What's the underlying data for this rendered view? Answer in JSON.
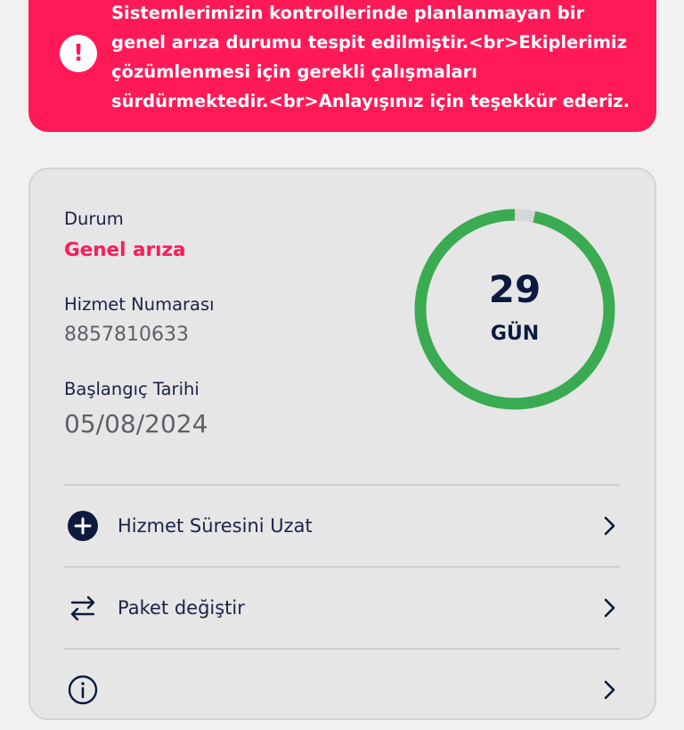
{
  "alert": {
    "icon": "exclamation-icon",
    "message": "Sistemlerimizin kontrollerinde planlanmayan bir\ngenel arıza durumu tespit edilmiştir.<br>Ekiplerimiz\nçözümlenmesi için gerekli çalışmaları\nsürdürmektedir.<br>Anlayışınız için teşekkür ederiz.",
    "color": "#ff1a57"
  },
  "service": {
    "status_label": "Durum",
    "status_value": "Genel arıza",
    "number_label": "Hizmet Numarası",
    "number_value": "8857810633",
    "start_label": "Başlangıç Tarihi",
    "start_value": "05/08/2024"
  },
  "countdown": {
    "days": "29",
    "unit": "GÜN",
    "progress_fraction": 0.967,
    "ring_color": "#3bab52",
    "track_color": "#d6d6d6"
  },
  "actions": [
    {
      "label": "Hizmet Süresini Uzat",
      "icon": "plus-circle-icon"
    },
    {
      "label": "Paket değiştir",
      "icon": "swap-arrows-icon"
    },
    {
      "label": "",
      "icon": "info-icon"
    }
  ]
}
